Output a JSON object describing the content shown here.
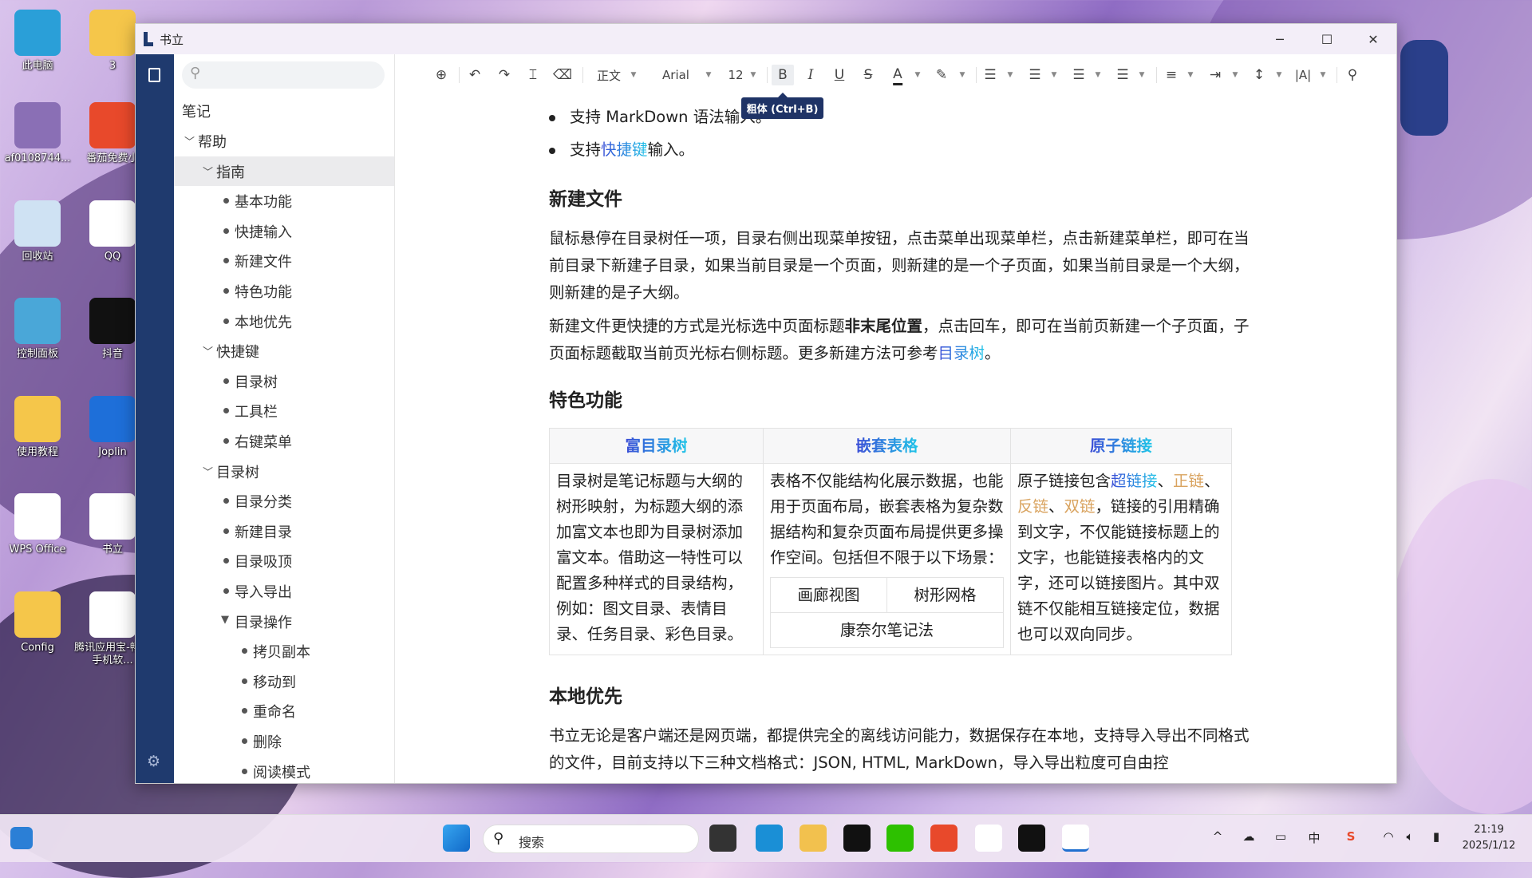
{
  "desktop": {
    "icons": [
      {
        "label": "此电脑",
        "icon": "monitor-icon",
        "color": "#2a9fd8"
      },
      {
        "label": "3",
        "icon": "folder-icon",
        "color": "#f5c64a"
      },
      {
        "label": "af0108744...",
        "icon": "image-thumbnail-icon",
        "color": "#8a6fb5"
      },
      {
        "label": "番茄免费小",
        "icon": "fanqie-app-icon",
        "color": "#e8492b"
      },
      {
        "label": "回收站",
        "icon": "recycle-bin-icon",
        "color": "#cfe2f3"
      },
      {
        "label": "QQ",
        "icon": "qq-icon",
        "color": "#ffffff"
      },
      {
        "label": "控制面板",
        "icon": "control-panel-icon",
        "color": "#4aa7d8"
      },
      {
        "label": "抖音",
        "icon": "douyin-icon",
        "color": "#111111"
      },
      {
        "label": "使用教程",
        "icon": "folder-icon",
        "color": "#f5c64a"
      },
      {
        "label": "Joplin",
        "icon": "joplin-icon",
        "color": "#1e6fd9"
      },
      {
        "label": "WPS Office",
        "icon": "wps-icon",
        "color": "#ffffff"
      },
      {
        "label": "书立",
        "icon": "shuli-icon",
        "color": "#ffffff"
      },
      {
        "label": "Config",
        "icon": "folder-icon",
        "color": "#f5c64a"
      },
      {
        "label": "腾讯应用宝-畅玩手机软...",
        "icon": "yingyongbao-icon",
        "color": "#ffffff"
      }
    ]
  },
  "window": {
    "title": "书立",
    "controls": {
      "minimize": "─",
      "maximize": "☐",
      "close": "✕"
    }
  },
  "sidebar": {
    "search_placeholder": "",
    "root": "笔记",
    "tree": [
      {
        "label": "帮助",
        "level": 1,
        "type": "folder",
        "expanded": true
      },
      {
        "label": "指南",
        "level": 2,
        "type": "folder",
        "expanded": true,
        "selected": true
      },
      {
        "label": "基本功能",
        "level": 3,
        "type": "page"
      },
      {
        "label": "快捷输入",
        "level": 3,
        "type": "page"
      },
      {
        "label": "新建文件",
        "level": 3,
        "type": "page"
      },
      {
        "label": "特色功能",
        "level": 3,
        "type": "page"
      },
      {
        "label": "本地优先",
        "level": 3,
        "type": "page"
      },
      {
        "label": "快捷键",
        "level": 2,
        "type": "folder",
        "expanded": true
      },
      {
        "label": "目录树",
        "level": 3,
        "type": "page"
      },
      {
        "label": "工具栏",
        "level": 3,
        "type": "page"
      },
      {
        "label": "右键菜单",
        "level": 3,
        "type": "page"
      },
      {
        "label": "目录树",
        "level": 2,
        "type": "folder",
        "expanded": true
      },
      {
        "label": "目录分类",
        "level": 3,
        "type": "page"
      },
      {
        "label": "新建目录",
        "level": 3,
        "type": "page"
      },
      {
        "label": "目录吸顶",
        "level": 3,
        "type": "page"
      },
      {
        "label": "导入导出",
        "level": 3,
        "type": "page"
      },
      {
        "label": "目录操作",
        "level": 3,
        "type": "folder",
        "expanded": true,
        "filled": true
      },
      {
        "label": "拷贝副本",
        "level": 4,
        "type": "page"
      },
      {
        "label": "移动到",
        "level": 4,
        "type": "page"
      },
      {
        "label": "重命名",
        "level": 4,
        "type": "page"
      },
      {
        "label": "删除",
        "level": 4,
        "type": "page"
      },
      {
        "label": "阅读模式",
        "level": 4,
        "type": "page"
      }
    ]
  },
  "toolbar": {
    "paragraph_style": "正文",
    "font": "Arial",
    "font_size": "12",
    "bold": "B",
    "italic": "I",
    "underline": "U",
    "strike": "S",
    "font_color": "A",
    "font_color_value": "#222222",
    "tooltip": "粗体 (Ctrl+B)",
    "bold_active": true
  },
  "document": {
    "bullets": [
      {
        "pre": "支持 MarkDown 语法输入。"
      },
      {
        "pre": "支持",
        "link": "快捷键",
        "post": "输入。"
      }
    ],
    "h_new": "新建文件",
    "p_new1": "鼠标悬停在目录树任一项，目录右侧出现菜单按钮，点击菜单出现菜单栏，点击新建菜单栏，即可在当前目录下新建子目录，如果当前目录是一个页面，则新建的是一个子页面，如果当前目录是一个大纲，则新建的是子大纲。",
    "p_new2_a": "新建文件更快捷的方式是光标选中页面标题",
    "p_new2_bold": "非末尾位置",
    "p_new2_b": "，点击回车，即可在当前页新建一个子页面，子页面标题截取当前页光标右侧标题。更多新建方法可参考",
    "p_new2_link": "目录树",
    "p_new2_c": "。",
    "h_feat": "特色功能",
    "table": {
      "headers": [
        "富目录树",
        "嵌套表格",
        "原子链接"
      ],
      "col1": "目录树是笔记标题与大纲的树形映射，为标题大纲的添加富文本也即为目录树添加富文本。借助这一特性可以配置多种样式的目录结构，例如：图文目录、表情目录、任务目录、彩色目录。",
      "col2": "表格不仅能结构化展示数据，也能用于页面布局，嵌套表格为复杂数据结构和复杂页面布局提供更多操作空间。包括但不限于以下场景：",
      "nested": [
        "画廊视图",
        "树形网格",
        "康奈尔笔记法"
      ],
      "col3_a": "原子链接包含",
      "col3_link1": "超链接",
      "sep": "、",
      "col3_link2": "正链",
      "col3_link3": "反链",
      "col3_link4": "双链",
      "col3_b": "，链接的引用精确到文字，不仅能链接标题上的文字，也能链接表格内的文字，还可以链接图片。其中双链不仅能相互链接定位，数据也可以双向同步。"
    },
    "h_local": "本地优先",
    "p_local": "书立无论是客户端还是网页端，都提供完全的离线访问能力，数据保存在本地，支持导入导出不同格式的文件，目前支持以下三种文档格式：JSON, HTML, MarkDown，导入导出粒度可自由控"
  },
  "taskbar": {
    "search_placeholder": "搜索",
    "apps": [
      "task-view-icon",
      "edge-icon",
      "file-explorer-icon",
      "douyin-icon",
      "wechat-icon",
      "weibo-icon",
      "qq-icon",
      "douyin-icon",
      "shuli-icon"
    ],
    "tray": {
      "ime": "中",
      "time": "21:19",
      "date": "2025/1/12"
    }
  }
}
